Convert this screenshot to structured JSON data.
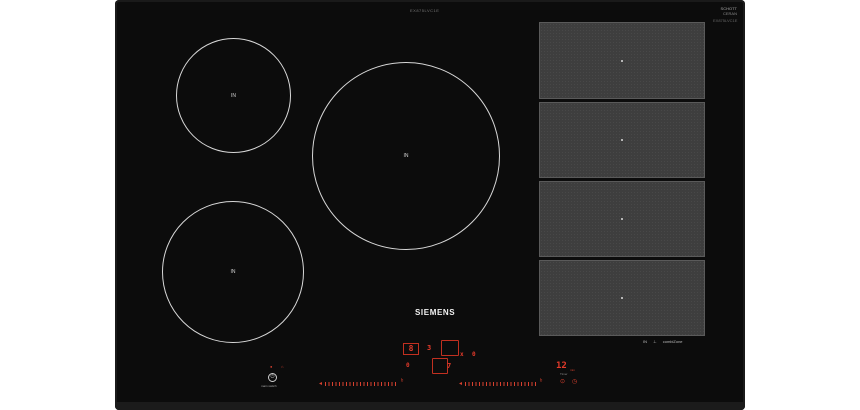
{
  "hob": {
    "model_number": "EX875LVC1E",
    "certification": [
      "SCHOTT",
      "CERAN",
      "EX875LVC1E"
    ],
    "brand": "SIEMENS"
  },
  "zones": [
    {
      "id": "top-left",
      "label": "IN"
    },
    {
      "id": "centre-large",
      "label": "IN"
    },
    {
      "id": "bottom-left",
      "label": "IN"
    }
  ],
  "flex_zones": [
    {
      "id": "flex-1"
    },
    {
      "id": "flex-2"
    },
    {
      "id": "flex-3"
    },
    {
      "id": "flex-4"
    }
  ],
  "flex_caption": {
    "induction": "IN",
    "symbol": "⊥",
    "text": "combiZone"
  },
  "controls": {
    "power_level_display": "8",
    "level_digit_a": "3",
    "level_digit_b": "0",
    "level_digit_c": "7",
    "multiply_symbol": "x",
    "zero_symbol": "0",
    "timer_value": "12",
    "timer_unit": "min",
    "timer_caption": "Timer",
    "main_switch_label": "main switch",
    "power_symbol": "⏻",
    "colors": {
      "accent": "#e23a2a",
      "surface": "#0c0c0c"
    }
  }
}
